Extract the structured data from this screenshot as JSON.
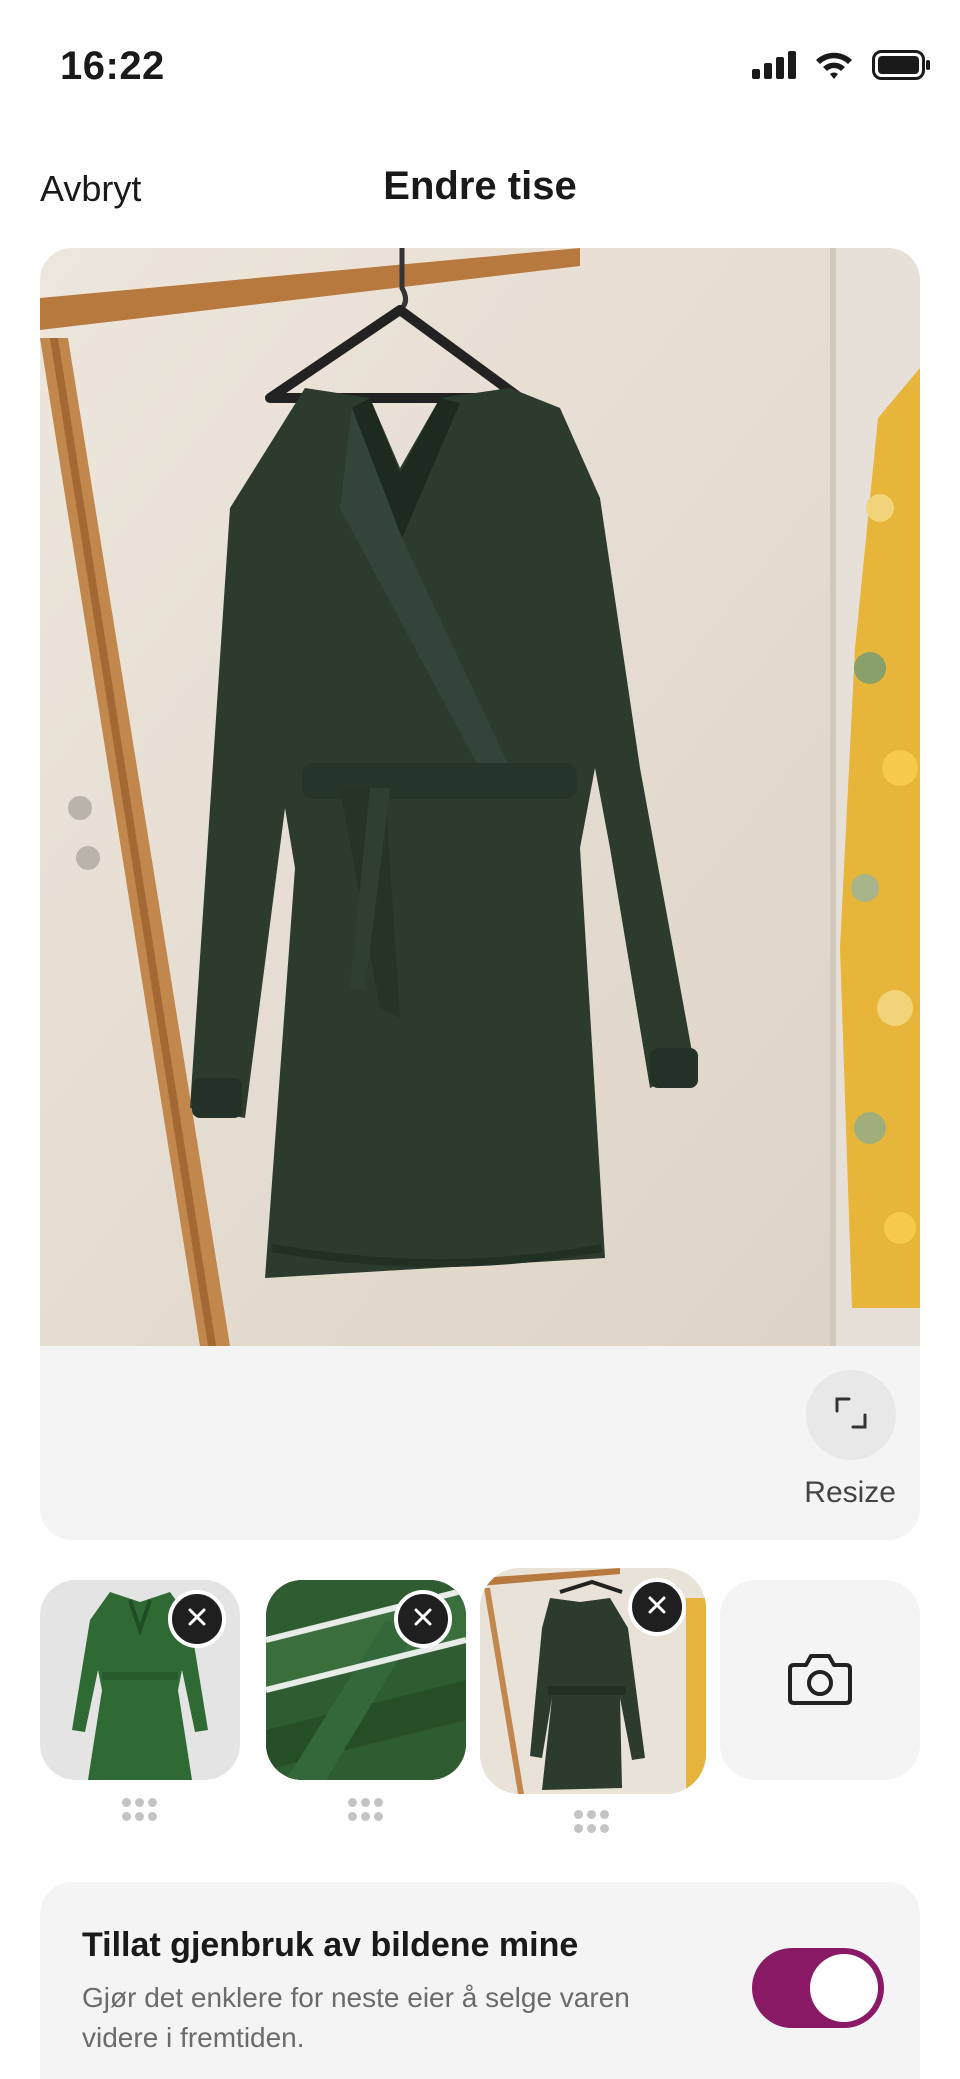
{
  "status_bar": {
    "time": "16:22"
  },
  "nav": {
    "cancel_label": "Avbryt",
    "title": "Endre tise"
  },
  "photo_editor": {
    "resize_label": "Resize"
  },
  "thumbnails": [
    {
      "name": "dress-product-photo"
    },
    {
      "name": "fabric-closeup-photo"
    },
    {
      "name": "dress-on-hanger-photo",
      "selected": true
    }
  ],
  "reuse": {
    "title": "Tillat gjenbruk av bildene mine",
    "description": "Gjør det enklere for neste eier å selge varen videre i fremtiden.",
    "enabled": true
  },
  "colors": {
    "accent": "#8a1a66",
    "dress": "#2c3b2e",
    "card_bg": "#f4f4f4"
  }
}
